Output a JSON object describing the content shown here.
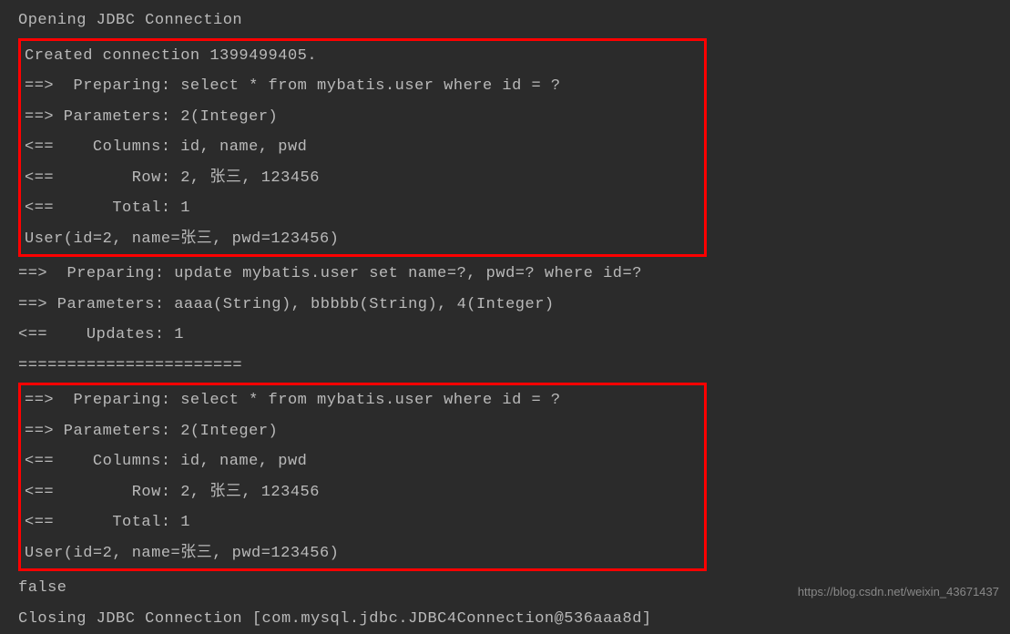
{
  "log": {
    "opening": "Opening JDBC Connection",
    "box1": {
      "line1": "Created connection 1399499405.",
      "line2": "==>  Preparing: select * from mybatis.user where id = ?",
      "line3": "==> Parameters: 2(Integer)",
      "line4": "<==    Columns: id, name, pwd",
      "line5": "<==        Row: 2, 张三, 123456",
      "line6": "<==      Total: 1",
      "line7": "User(id=2, name=张三, pwd=123456)"
    },
    "middle": {
      "line1": "==>  Preparing: update mybatis.user set name=?, pwd=? where id=?",
      "line2": "==> Parameters: aaaa(String), bbbbb(String), 4(Integer)",
      "line3": "<==    Updates: 1",
      "line4": "======================="
    },
    "box2": {
      "line1": "==>  Preparing: select * from mybatis.user where id = ?",
      "line2": "==> Parameters: 2(Integer)",
      "line3": "<==    Columns: id, name, pwd",
      "line4": "<==        Row: 2, 张三, 123456",
      "line5": "<==      Total: 1",
      "line6": "User(id=2, name=张三, pwd=123456)"
    },
    "after": {
      "line1": "false",
      "line2": "Closing JDBC Connection [com.mysql.jdbc.JDBC4Connection@536aaa8d]"
    }
  },
  "watermark": "https://blog.csdn.net/weixin_43671437"
}
